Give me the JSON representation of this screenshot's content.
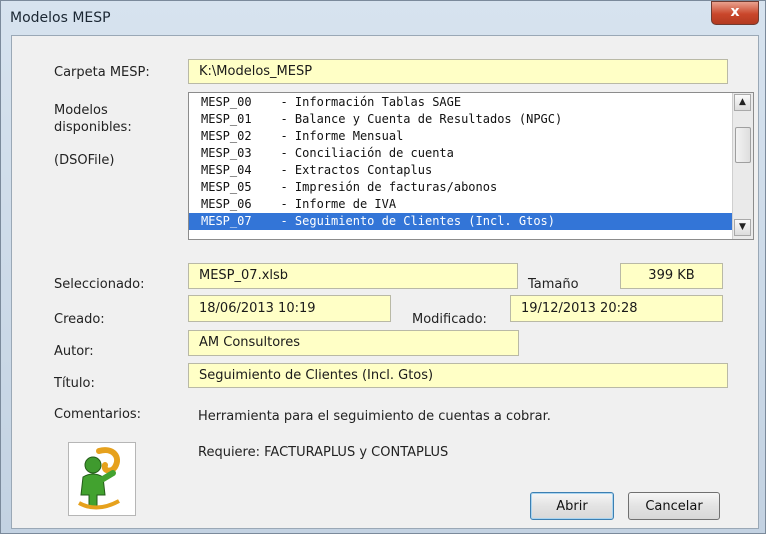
{
  "window": {
    "title": "Modelos MESP",
    "close_glyph": "x"
  },
  "labels": {
    "carpeta": "Carpeta MESP:",
    "modelos": "Modelos\ndisponibles:",
    "dsofile": "(DSOFile)",
    "seleccionado": "Seleccionado:",
    "tamano": "Tamaño",
    "creado": "Creado:",
    "modificado": "Modificado:",
    "autor": "Autor:",
    "titulo": "Título:",
    "comentarios": "Comentarios:"
  },
  "fields": {
    "carpeta": "K:\\Modelos_MESP",
    "seleccionado": "MESP_07.xlsb",
    "tamano": "399 KB",
    "creado": "18/06/2013 10:19",
    "modificado": "19/12/2013 20:28",
    "autor": "AM Consultores",
    "titulo": "Seguimiento de Clientes (Incl. Gtos)"
  },
  "models": [
    "MESP_00    - Información Tablas SAGE",
    "MESP_01    - Balance y Cuenta de Resultados (NPGC)",
    "MESP_02    - Informe Mensual",
    "MESP_03    - Conciliación de cuenta",
    "MESP_04    - Extractos Contaplus",
    "MESP_05    - Impresión de facturas/abonos",
    "MESP_06    - Informe de IVA",
    "MESP_07    - Seguimiento de Clientes (Incl. Gtos)"
  ],
  "selected_index": 7,
  "comments": {
    "line1": "Herramienta para el seguimiento de cuentas a cobrar.",
    "line2": "Requiere: FACTURAPLUS y CONTAPLUS"
  },
  "buttons": {
    "open": "Abrir",
    "cancel": "Cancelar"
  },
  "icons": {
    "scroll_up": "▲",
    "scroll_down": "▼",
    "logo": "person-icon"
  },
  "colors": {
    "field_bg": "#ffffc6",
    "selection": "#3375d7",
    "close": "#c9462b"
  }
}
